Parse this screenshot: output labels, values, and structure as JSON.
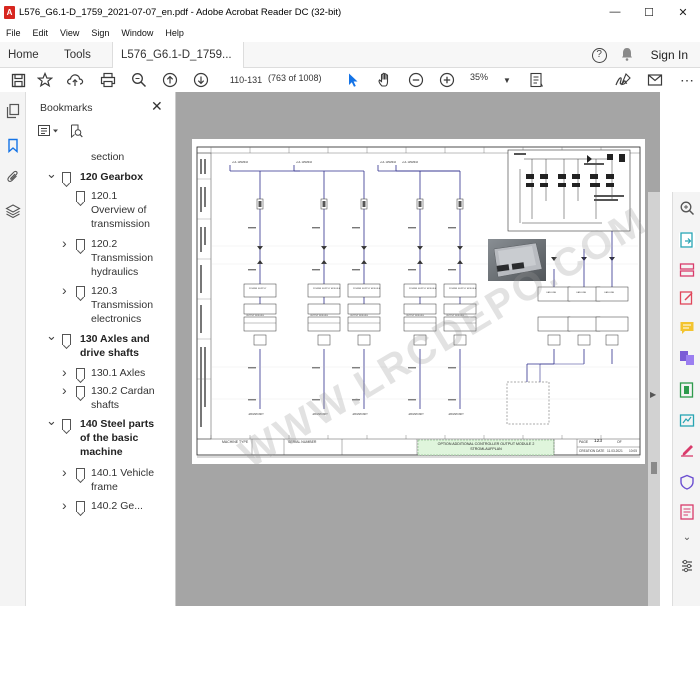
{
  "window": {
    "title": "L576_G6.1-D_1759_2021-07-07_en.pdf - Adobe Acrobat Reader DC (32-bit)",
    "app_icon": "acrobat-icon",
    "minimize": "—",
    "maximize": "☐",
    "close": "✕"
  },
  "menu": [
    "File",
    "Edit",
    "View",
    "Sign",
    "Window",
    "Help"
  ],
  "tabs": {
    "home": "Home",
    "tools": "Tools",
    "document": "L576_G6.1-D_1759...",
    "close": "×",
    "help": "?",
    "signin": "Sign In"
  },
  "toolbar": {
    "page_input": "110-131",
    "page_count": "(763 of 1008)",
    "zoom": "35%",
    "icons": [
      "save-icon",
      "bookmark-star-icon",
      "upload-icon",
      "print-icon",
      "zoom-search-icon",
      "page-up-icon",
      "page-down-icon",
      "select-arrow-icon",
      "hand-icon",
      "zoom-out-icon",
      "zoom-in-icon",
      "zoom-dropdown-icon",
      "fit-page-icon",
      "sign-icon",
      "mail-icon",
      "more-icon"
    ]
  },
  "bookmarks": {
    "title": "Bookmarks",
    "close": "✕",
    "items": [
      {
        "label_lines": [
          "section"
        ],
        "bold": false,
        "level": 2,
        "chevron": false
      },
      {
        "label_lines": [
          "120 Gearbox"
        ],
        "bold": true,
        "level": 1,
        "chevron": "down"
      },
      {
        "label_lines": [
          "120.1",
          "Overview of",
          "transmission"
        ],
        "bold": false,
        "level": 2,
        "chevron": false
      },
      {
        "label_lines": [
          "120.2",
          "Transmission",
          "hydraulics"
        ],
        "bold": false,
        "level": 2,
        "chevron": "right"
      },
      {
        "label_lines": [
          "120.3",
          "Transmission",
          "electronics"
        ],
        "bold": false,
        "level": 2,
        "chevron": "right"
      },
      {
        "label_lines": [
          "130 Axles and",
          "drive shafts"
        ],
        "bold": true,
        "level": 1,
        "chevron": "down"
      },
      {
        "label_lines": [
          "130.1 Axles"
        ],
        "bold": false,
        "level": 2,
        "chevron": "right"
      },
      {
        "label_lines": [
          "130.2 Cardan",
          "shafts"
        ],
        "bold": false,
        "level": 2,
        "chevron": "right"
      },
      {
        "label_lines": [
          "140 Steel parts",
          "of the basic",
          "machine"
        ],
        "bold": true,
        "level": 1,
        "chevron": "down"
      },
      {
        "label_lines": [
          "140.1 Vehicle",
          "frame"
        ],
        "bold": false,
        "level": 2,
        "chevron": "right"
      },
      {
        "label_lines": [
          "140.2 Ge..."
        ],
        "bold": false,
        "level": 2,
        "chevron": "right"
      }
    ]
  },
  "document": {
    "footer_title": "OPTION ADDITIONAL CONTROLLER OUTPUT MODULE 2",
    "footer_sub": "STROMLAUFPLAN",
    "page_label": "PAGE",
    "page_no": "123",
    "of_label": "OF",
    "creation_label": "CREATION DATE",
    "creation_date": "11.03.2021",
    "creation_time": "10:05",
    "machine_type_label": "MACHINE TYPE",
    "serial_label": "SERIAL NUMBER",
    "watermark": "WWW.LRCDEPO.COM",
    "net_labels": [
      "+UL 115M310",
      "+UL 115M310",
      "+UL 115M310",
      "+UL 115M310"
    ],
    "module_labels": [
      "POWER SUPPLY",
      "POWER SUPPLY MODULE",
      "POWER SUPPLY MODULE",
      "POWER SUPPLY MODULE",
      "POWER SUPPLY MODULE"
    ],
    "output_labels": [
      "OUTPUT MODULE",
      "OUTPUT MODULE",
      "OUTPUT MODULE",
      "OUTPUT MODULE"
    ],
    "right_modules": [
      "CAN LINE",
      "CAN LINE",
      "CAN LINE"
    ],
    "ground_labels": [
      "-MASSPUNKT",
      "-MASSPUNKT",
      "-MASSPUNKT",
      "-MASSPUNKT",
      "-MASSPUNKT"
    ]
  },
  "colors": {
    "wire": "#2e2e8c",
    "page_bg": "#ffffff",
    "doc_bg": "#a5a5a5",
    "footer_green": "#dff5dc",
    "accent_blue": "#1473e6"
  }
}
